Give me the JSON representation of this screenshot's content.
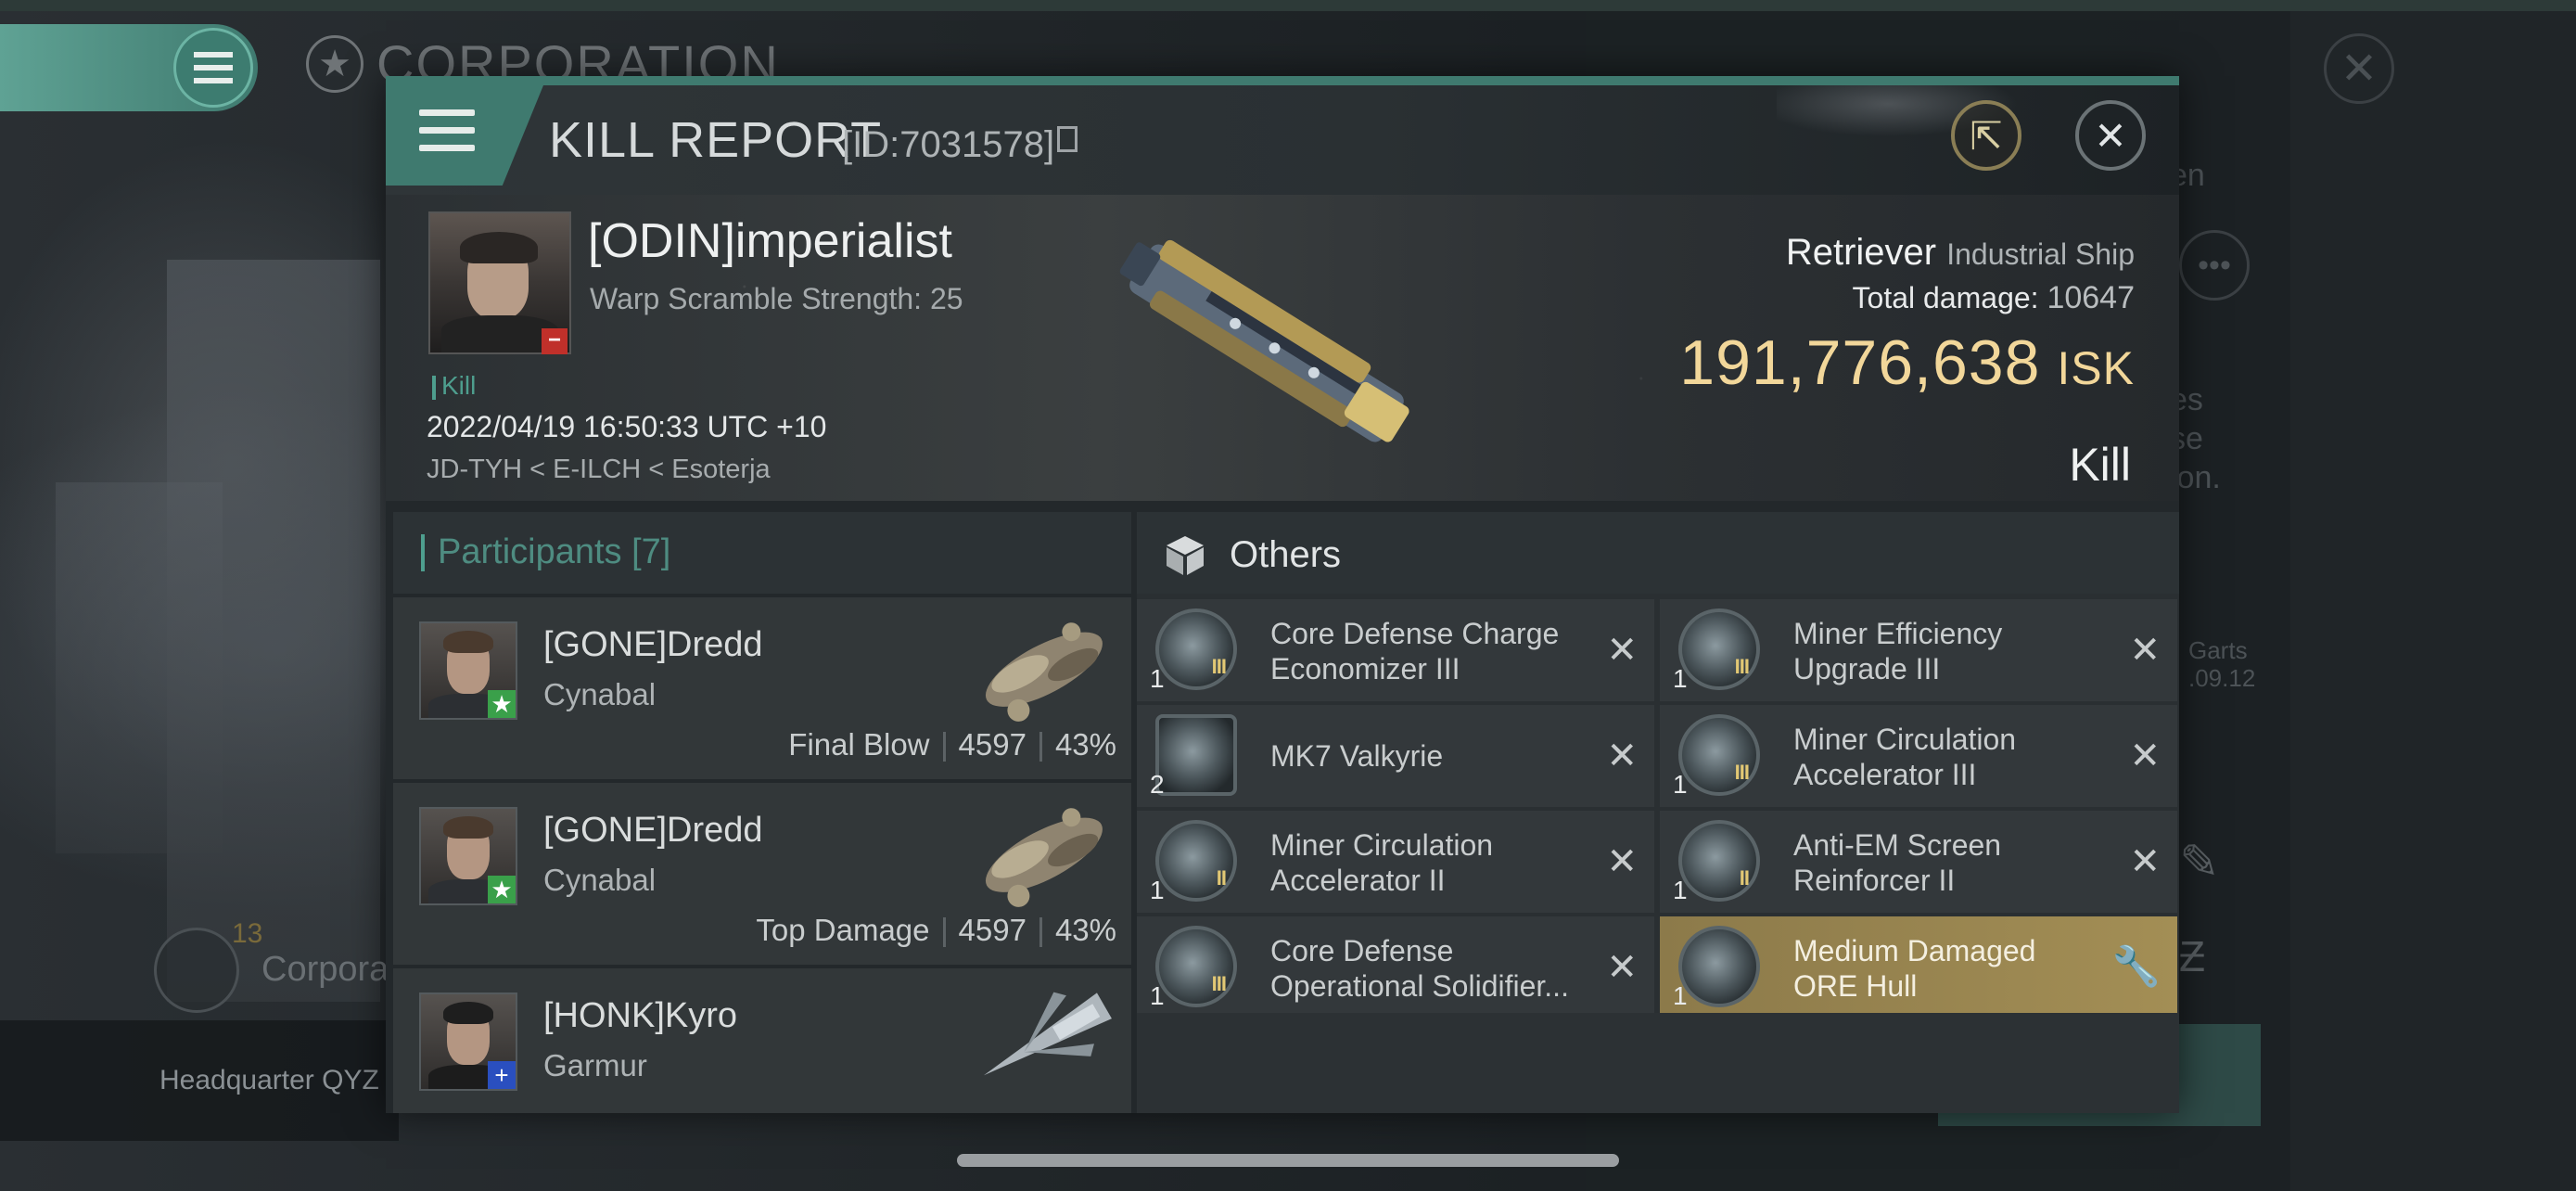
{
  "background": {
    "corporation_title": "CORPORATION",
    "side_text_1": "en",
    "side_text_2": "es\nse\nion.",
    "side_text_3": "Garts\n.09.12",
    "corp_count": "13",
    "corp_label": "Corpora",
    "hq_label": "Headquarter QYZ"
  },
  "modal": {
    "title": "KILL REPORT",
    "id_text": "[ID:7031578]"
  },
  "victim": {
    "name": "[ODIN]imperialist",
    "warp_scramble": "Warp Scramble Strength: 25",
    "kill_tag": "Kill",
    "timestamp": "2022/04/19 16:50:33 UTC +10",
    "location": "JD-TYH < E-ILCH < Esoterja"
  },
  "ship": {
    "name": "Retriever",
    "class": "Industrial Ship",
    "total_damage_label": "Total damage:",
    "total_damage_value": "10647",
    "isk_value": "191,776,638",
    "isk_unit": "ISK",
    "result": "Kill"
  },
  "participants": {
    "title": "Participants [7]",
    "rows": [
      {
        "name": "[GONE]Dredd",
        "ship": "Cynabal",
        "role": "Final Blow",
        "damage": "4597",
        "percent": "43%"
      },
      {
        "name": "[GONE]Dredd",
        "ship": "Cynabal",
        "role": "Top Damage",
        "damage": "4597",
        "percent": "43%"
      },
      {
        "name": "[HONK]Kyro",
        "ship": "Garmur",
        "role": "",
        "damage": "",
        "percent": ""
      }
    ]
  },
  "others": {
    "title": "Others",
    "items": [
      {
        "qty": "1",
        "tier": "III",
        "name": "Core Defense Charge Economizer III"
      },
      {
        "qty": "1",
        "tier": "III",
        "name": "Miner Efficiency Upgrade III"
      },
      {
        "qty": "2",
        "tier": "",
        "name": "MK7  Valkyrie"
      },
      {
        "qty": "1",
        "tier": "III",
        "name": "Miner Circulation Accelerator III"
      },
      {
        "qty": "1",
        "tier": "II",
        "name": "Miner Circulation Accelerator II"
      },
      {
        "qty": "1",
        "tier": "II",
        "name": "Anti-EM Screen Reinforcer II"
      },
      {
        "qty": "1",
        "tier": "III",
        "name": "Core Defense Operational Solidifier..."
      },
      {
        "qty": "1",
        "tier": "",
        "name": "Medium Damaged ORE Hull"
      }
    ]
  },
  "colors": {
    "accent_teal": "#3f7a6f",
    "isk_gold": "#f2d79a",
    "hull_highlight": "#a38e55"
  }
}
